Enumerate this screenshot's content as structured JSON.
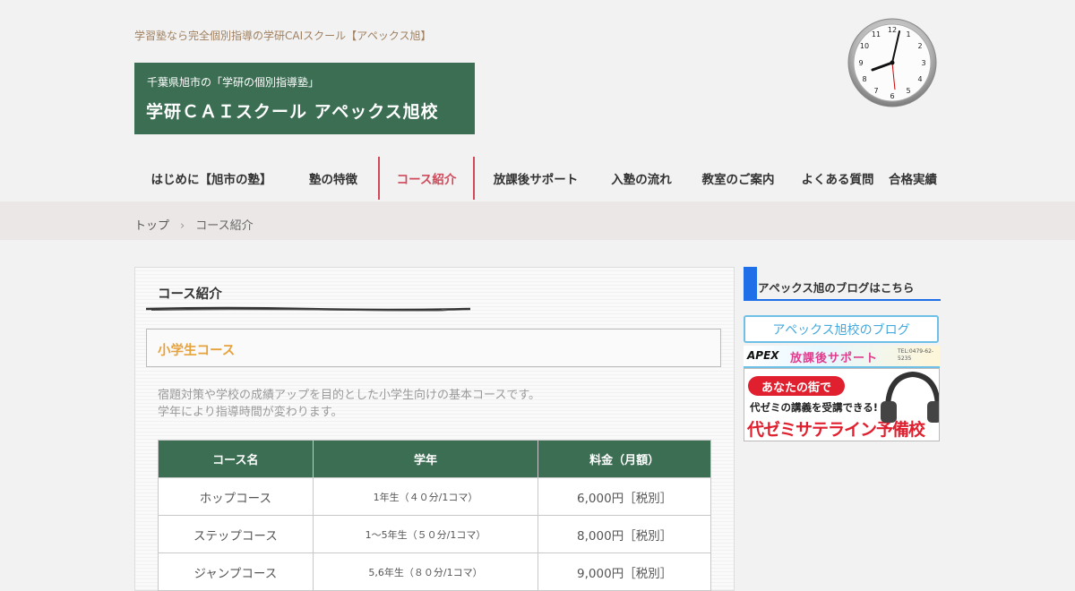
{
  "header": {
    "tagline": "学習塾なら完全個別指導の学研CAIスクール【アペックス旭】",
    "logo_sub": "千葉県旭市の「学研の個別指導塾」",
    "logo_main": "学研ＣＡＩスクール アペックス旭校"
  },
  "nav": {
    "items": [
      {
        "label": "はじめに【旭市の塾】"
      },
      {
        "label": "塾の特徴"
      },
      {
        "label": "コース紹介"
      },
      {
        "label": "放課後サポート"
      },
      {
        "label": "入塾の流れ"
      },
      {
        "label": "教室のご案内"
      },
      {
        "label": "よくある質問"
      },
      {
        "label": "合格実績"
      }
    ],
    "active_index": 2
  },
  "breadcrumb": {
    "home": "トップ",
    "separator": "›",
    "current": "コース紹介"
  },
  "main": {
    "title": "コース紹介",
    "section_title": "小学生コース",
    "desc_line1": "宿題対策や学校の成績アップを目的とした小学生向けの基本コースです。",
    "desc_line2": "学年により指導時間が変わります。",
    "table": {
      "headers": [
        "コース名",
        "学年",
        "料金（月額）"
      ],
      "rows": [
        {
          "name": "ホップコース",
          "grade": "1年生（４０分/1コマ）",
          "price": "6,000円［税別］"
        },
        {
          "name": "ステップコース",
          "grade": "1～5年生（５０分/1コマ）",
          "price": "8,000円［税別］"
        },
        {
          "name": "ジャンプコース",
          "grade": "5,6年生（８０分/1コマ）",
          "price": "9,000円［税別］"
        }
      ]
    }
  },
  "sidebar": {
    "heading": "アペックス旭のブログはこちら",
    "blog_button": "アペックス旭校のブログ",
    "banner1": {
      "brand": "APEX",
      "text": "放課後サポート",
      "phone": "TEL:0479-62-5235"
    },
    "banner2": {
      "pill": "あなたの街で",
      "line2": "代ゼミの講義を受講できる!",
      "line3": "代ゼミサテライン予備校"
    }
  },
  "colors": {
    "brand_green": "#3c6e53",
    "active_nav": "#d1495b",
    "section_title": "#e6a23c",
    "sidebar_accent": "#1e6fe8",
    "blog_button": "#45a9dc"
  },
  "icons": {
    "clock": "analog-clock-icon"
  }
}
